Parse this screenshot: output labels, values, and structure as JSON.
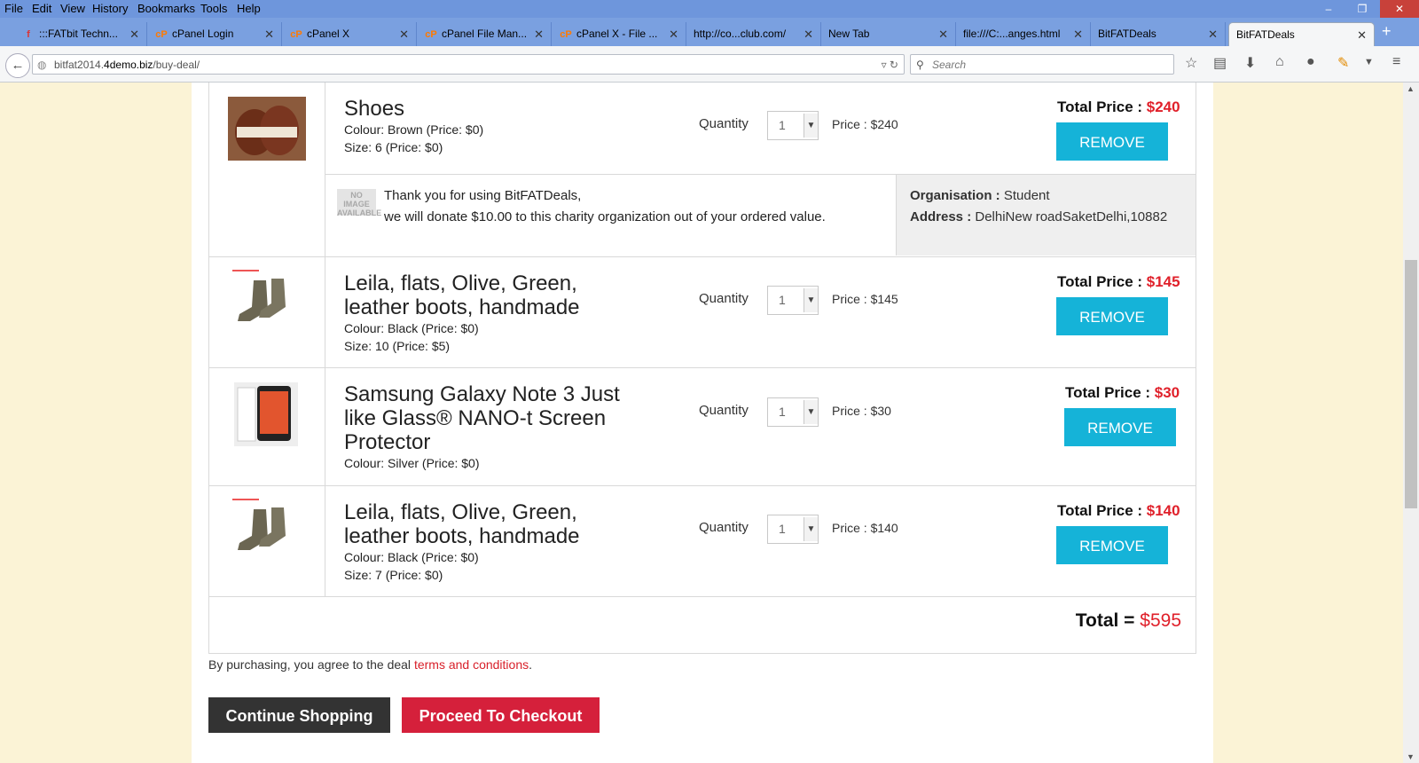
{
  "menu": [
    "File",
    "Edit",
    "View",
    "History",
    "Bookmarks",
    "Tools",
    "Help"
  ],
  "window_controls": {
    "minimize": "–",
    "restore": "❐",
    "close": "✕"
  },
  "tabs": [
    {
      "label": ":::FATbit Techn...",
      "icon": "fatbit-icon"
    },
    {
      "label": "cPanel Login",
      "icon": "cpanel-icon"
    },
    {
      "label": "cPanel X",
      "icon": "cpanel-icon"
    },
    {
      "label": "cPanel File Man...",
      "icon": "cpanel-icon"
    },
    {
      "label": "cPanel X - File ...",
      "icon": "cpanel-icon"
    },
    {
      "label": "http://co...club.com/",
      "icon": ""
    },
    {
      "label": "New Tab",
      "icon": ""
    },
    {
      "label": "file:///C:...anges.html",
      "icon": ""
    },
    {
      "label": "BitFATDeals",
      "icon": ""
    },
    {
      "label": "BitFATDeals",
      "icon": "",
      "active": true
    }
  ],
  "url": {
    "pre": "bitfat2014.",
    "host": "4demo.biz",
    "path": "/buy-deal/"
  },
  "search_placeholder": "Search",
  "cart": {
    "quantity_label": "Quantity",
    "remove_label": "REMOVE",
    "total_price_label": "Total Price : ",
    "items": [
      {
        "name": "Shoes",
        "attrs": [
          "Colour: Brown (Price: $0)",
          "Size: 6 (Price: $0)"
        ],
        "qty": "1",
        "price": "Price : $240",
        "total": "$240"
      },
      {
        "name": "Leila, flats, Olive, Green, leather boots, handmade",
        "attrs": [
          "Colour: Black (Price: $0)",
          "Size: 10 (Price: $5)"
        ],
        "qty": "1",
        "price": "Price : $145",
        "total": "$145"
      },
      {
        "name": "Samsung Galaxy Note 3 Just like Glass® NANO-t Screen Protector",
        "attrs": [
          "Colour: Silver (Price: $0)"
        ],
        "qty": "1",
        "price": "Price : $30",
        "total": "$30"
      },
      {
        "name": "Leila, flats, Olive, Green, leather boots, handmade",
        "attrs": [
          "Colour: Black (Price: $0)",
          "Size: 7 (Price: $0)"
        ],
        "qty": "1",
        "price": "Price : $140",
        "total": "$140"
      }
    ],
    "charity": {
      "no_image_text": "NO IMAGE AVAILABLE",
      "line1": "Thank you for using BitFATDeals,",
      "line2": "we will donate $10.00 to this charity organization out of your ordered value.",
      "org_label": "Organisation : ",
      "org_value": "Student",
      "address_label": "Address : ",
      "address_value": "DelhiNew roadSaketDelhi,10882"
    },
    "grand_total_label": "Total = ",
    "grand_total_value": "$595"
  },
  "terms": {
    "prefix": "By purchasing, you agree to the deal ",
    "link": "terms and conditions",
    "suffix": "."
  },
  "buttons": {
    "continue": "Continue Shopping",
    "checkout": "Proceed To Checkout"
  },
  "colors": {
    "accent_blue": "#15b3d8",
    "price_red": "#e0202a",
    "checkout_red": "#d5203b"
  }
}
